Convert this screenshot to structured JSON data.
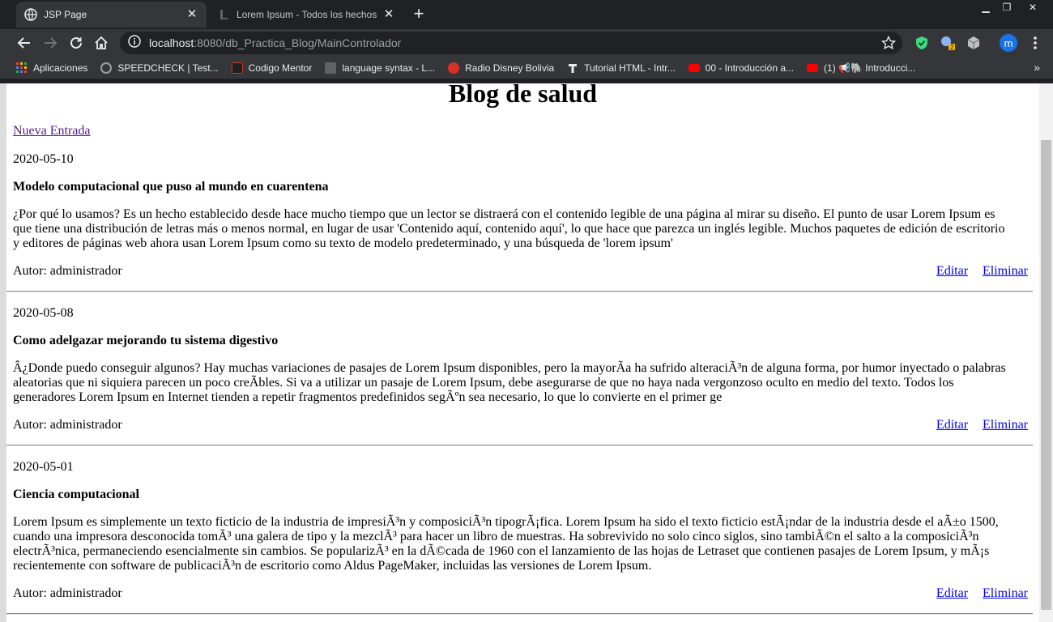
{
  "browser": {
    "tabs": [
      {
        "title": "JSP Page",
        "active": true
      },
      {
        "title": "Lorem Ipsum - Todos los hechos",
        "active": false
      }
    ],
    "url_host": "localhost",
    "url_path": ":8080/db_Practica_Blog/MainControlador",
    "profile_initial": "m",
    "extension_badge": "2",
    "bookmarks": [
      {
        "label": "Aplicaciones",
        "icon": "apps-grid-icon",
        "color": "#ea4335"
      },
      {
        "label": "SPEEDCHECK | Test...",
        "icon": "speedcheck-icon",
        "color": "#9aa0a6"
      },
      {
        "label": "Codigo Mentor",
        "icon": "codigo-mentor-icon",
        "color": "#c0392b"
      },
      {
        "label": "language syntax - L...",
        "icon": "page-icon",
        "color": "#5f6368"
      },
      {
        "label": "Radio Disney Bolivia",
        "icon": "radio-icon",
        "color": "#d93025"
      },
      {
        "label": "Tutorial HTML - Intr...",
        "icon": "tutorial-icon",
        "color": "#e8eaed"
      },
      {
        "label": "00 - Introducción a...",
        "icon": "youtube-icon",
        "color": "#ff0000"
      },
      {
        "label": "(1) 📢🐘 Introducci...",
        "icon": "youtube-icon",
        "color": "#ff0000"
      }
    ],
    "more_bookmarks": "»"
  },
  "page": {
    "title": "Blog de salud",
    "new_entry_link": "Nueva Entrada",
    "posts": [
      {
        "date": "2020-05-10",
        "title": "Modelo computacional que puso al mundo en cuarentena",
        "body": "¿Por qué lo usamos? Es un hecho establecido desde hace mucho tiempo que un lector se distraerá con el contenido legible de una página al mirar su diseño. El punto de usar Lorem Ipsum es que tiene una distribución de letras más o menos normal, en lugar de usar 'Contenido aquí, contenido aquí', lo que hace que parezca un inglés legible. Muchos paquetes de edición de escritorio y editores de páginas web ahora usan Lorem Ipsum como su texto de modelo predeterminado, y una búsqueda de 'lorem ipsum'",
        "author": "Autor: administrador",
        "edit": "Editar",
        "delete": "Eliminar"
      },
      {
        "date": "2020-05-08",
        "title": "Como adelgazar mejorando tu sistema digestivo",
        "body": "Â¿Donde puedo conseguir algunos? Hay muchas variaciones de pasajes de Lorem Ipsum disponibles, pero la mayorÃa ha sufrido alteraciÃ³n de alguna forma, por humor inyectado o palabras aleatorias que ni siquiera parecen un poco creÃbles. Si va a utilizar un pasaje de Lorem Ipsum, debe asegurarse de que no haya nada vergonzoso oculto en medio del texto. Todos los generadores Lorem Ipsum en Internet tienden a repetir fragmentos predefinidos segÃºn sea necesario, lo que lo convierte en el primer ge",
        "author": "Autor: administrador",
        "edit": "Editar",
        "delete": "Eliminar"
      },
      {
        "date": "2020-05-01",
        "title": "Ciencia computacional",
        "body": "Lorem Ipsum es simplemente un texto ficticio de la industria de impresiÃ³n y composiciÃ³n tipogrÃ¡fica. Lorem Ipsum ha sido el texto ficticio estÃ¡ndar de la industria desde el aÃ±o 1500, cuando una impresora desconocida tomÃ³ una galera de tipo y la mezclÃ³ para hacer un libro de muestras. Ha sobrevivido no solo cinco siglos, sino tambiÃ©n el salto a la composiciÃ³n electrÃ³nica, permaneciendo esencialmente sin cambios. Se popularizÃ³ en la dÃ©cada de 1960 con el lanzamiento de las hojas de Letraset que contienen pasajes de Lorem Ipsum, y mÃ¡s recientemente con software de publicaciÃ³n de escritorio como Aldus PageMaker, incluidas las versiones de Lorem Ipsum.",
        "author": "Autor: administrador",
        "edit": "Editar",
        "delete": "Eliminar"
      }
    ]
  }
}
